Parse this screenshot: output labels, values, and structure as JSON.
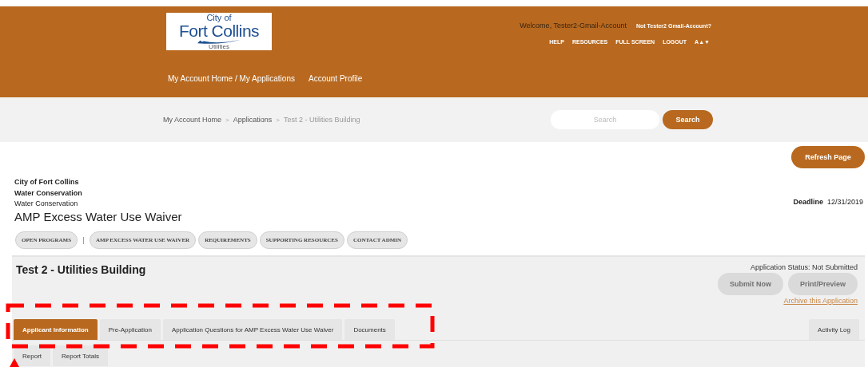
{
  "header": {
    "logo": {
      "line_1": "City of",
      "line_2": "Fort Collins",
      "line_3": "Utilities"
    },
    "welcome": "Welcome, Tester2-Gmail-Account",
    "not_user_link": "Not Tester2 Gmail-Account?",
    "utility_links": [
      "HELP",
      "RESOURCES",
      "FULL SCREEN",
      "LOGOUT",
      "A▲▼"
    ],
    "nav": [
      "My Account Home / My Applications",
      "Account Profile"
    ]
  },
  "breadcrumb": {
    "items": [
      "My Account Home",
      "Applications",
      "Test 2 - Utilities Building"
    ],
    "separator": ">"
  },
  "search": {
    "placeholder": "Search",
    "button": "Search"
  },
  "refresh_button": "Refresh Page",
  "program": {
    "org": "City of Fort Collins",
    "department": "Water Conservation",
    "division": "Water Conservation",
    "title": "AMP Excess Water Use Waiver",
    "deadline_label": "Deadline",
    "deadline": "12/31/2019"
  },
  "program_links": [
    {
      "label": "OPEN PROGRAMS"
    },
    {
      "label": "AMP EXCESS WATER USE WAIVER"
    },
    {
      "label": "REQUIREMENTS"
    },
    {
      "label": "SUPPORTING RESOURCES"
    },
    {
      "label": "CONTACT ADMIN"
    }
  ],
  "application": {
    "title": "Test 2 - Utilities Building",
    "status": "Application Status: Not Submitted",
    "buttons": [
      {
        "label": "Submit Now",
        "disabled": true
      },
      {
        "label": "Print/Preview",
        "disabled": true
      }
    ],
    "archive_link": "Archive this Application"
  },
  "tabs": [
    {
      "label": "Applicant Information",
      "selected": true
    },
    {
      "label": "Pre-Application",
      "selected": false
    },
    {
      "label": "Application Questions for AMP Excess Water Use Waiver",
      "selected": false
    },
    {
      "label": "Documents",
      "selected": false
    }
  ],
  "activity_log": "Activity Log",
  "report_tabs": [
    {
      "label": "Report",
      "selected": false
    },
    {
      "label": "Report Totals",
      "selected": false
    }
  ]
}
